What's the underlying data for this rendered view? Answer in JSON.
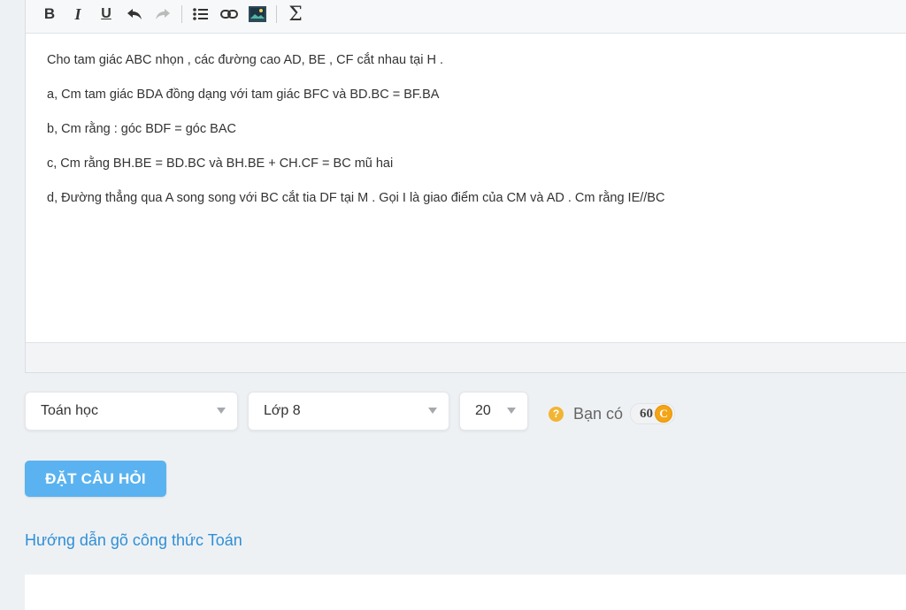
{
  "toolbar": {
    "bold": "B",
    "italic": "I",
    "underline": "U",
    "undo": "↶",
    "redo": "↷",
    "sigma": "Σ"
  },
  "content": {
    "lines": [
      "Cho tam giác ABC nhọn , các đường cao AD, BE , CF cắt nhau tại H .",
      "a, Cm tam giác BDA đồng dạng với tam giác BFC và BD.BC = BF.BA",
      "b, Cm rằng : góc BDF = góc BAC",
      "c, Cm rằng BH.BE = BD.BC và BH.BE + CH.CF = BC mũ hai",
      "d, Đường thẳng qua A song song với BC cắt tia DF tại M . Gọi I là giao điểm của CM và AD . Cm rằng IE//BC"
    ]
  },
  "form": {
    "subject": "Toán học",
    "grade": "Lớp 8",
    "points": "20",
    "coins_label": "Bạn có",
    "coins_value": "60",
    "coin_symbol": "C",
    "help_symbol": "?",
    "ask_button": "ĐẶT CÂU HỎI",
    "guide_link": "Hướng dẫn gõ công thức Toán"
  },
  "colors": {
    "accent": "#5ab3f0",
    "link": "#2f8fd6",
    "coin": "#f4a416"
  }
}
